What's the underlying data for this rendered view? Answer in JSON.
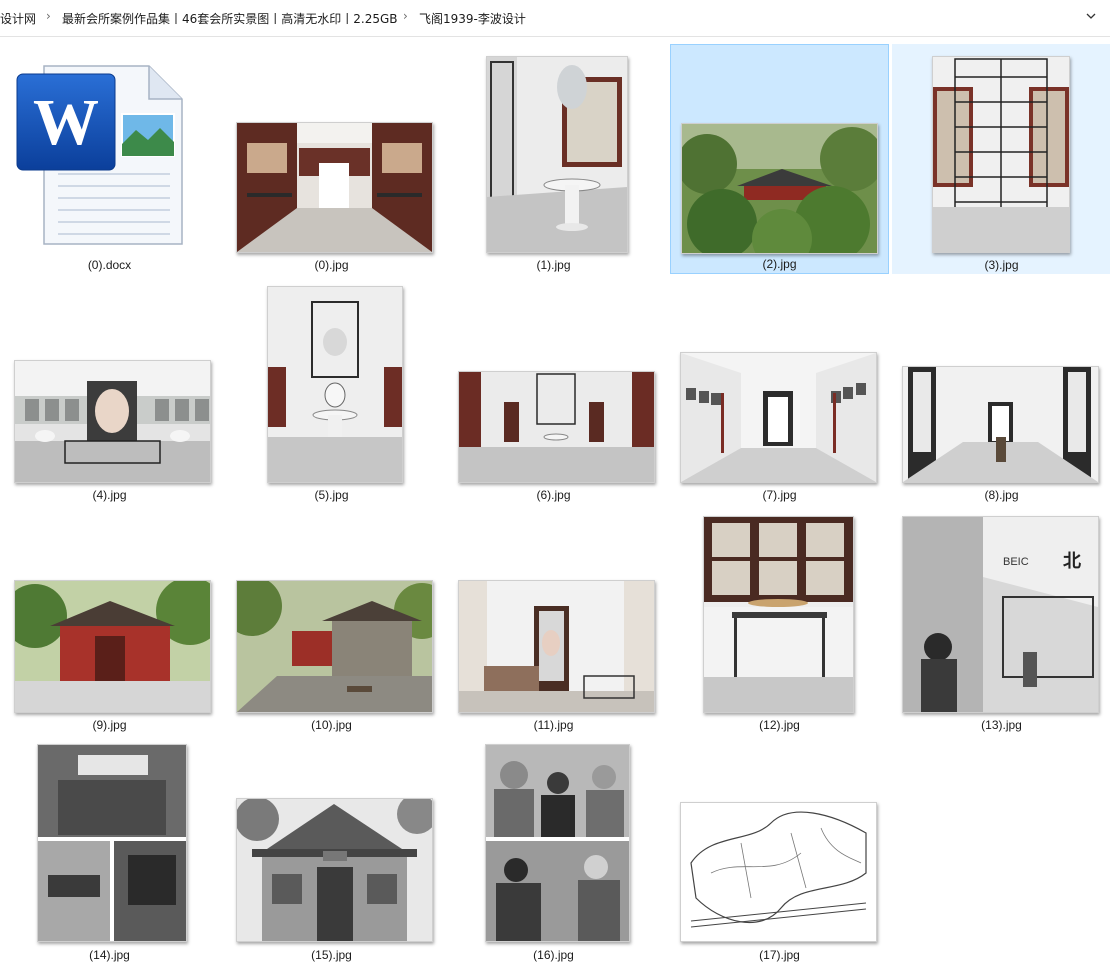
{
  "breadcrumb": {
    "items": [
      "设计网",
      "最新会所案例作品集丨46套会所实景图丨高清无水印丨2.25GB",
      "飞阁1939-李波设计"
    ]
  },
  "files": [
    {
      "name": "(0).docx",
      "kind": "docx"
    },
    {
      "name": "(0).jpg",
      "kind": "interior-red"
    },
    {
      "name": "(1).jpg",
      "kind": "interior-chandelier"
    },
    {
      "name": "(2).jpg",
      "kind": "garden-house",
      "selected": true
    },
    {
      "name": "(3).jpg",
      "kind": "shelf-room",
      "hovered": true
    },
    {
      "name": "(4).jpg",
      "kind": "round-room"
    },
    {
      "name": "(5).jpg",
      "kind": "interior-vase"
    },
    {
      "name": "(6).jpg",
      "kind": "interior-wide"
    },
    {
      "name": "(7).jpg",
      "kind": "gallery"
    },
    {
      "name": "(8).jpg",
      "kind": "corridor"
    },
    {
      "name": "(9).jpg",
      "kind": "red-pavilion"
    },
    {
      "name": "(10).jpg",
      "kind": "stone-pavilion"
    },
    {
      "name": "(11).jpg",
      "kind": "living-room"
    },
    {
      "name": "(12).jpg",
      "kind": "window-console"
    },
    {
      "name": "(13).jpg",
      "kind": "bw-library"
    },
    {
      "name": "(14).jpg",
      "kind": "bw-collage"
    },
    {
      "name": "(15).jpg",
      "kind": "bw-building"
    },
    {
      "name": "(16).jpg",
      "kind": "bw-people"
    },
    {
      "name": "(17).jpg",
      "kind": "map"
    }
  ]
}
